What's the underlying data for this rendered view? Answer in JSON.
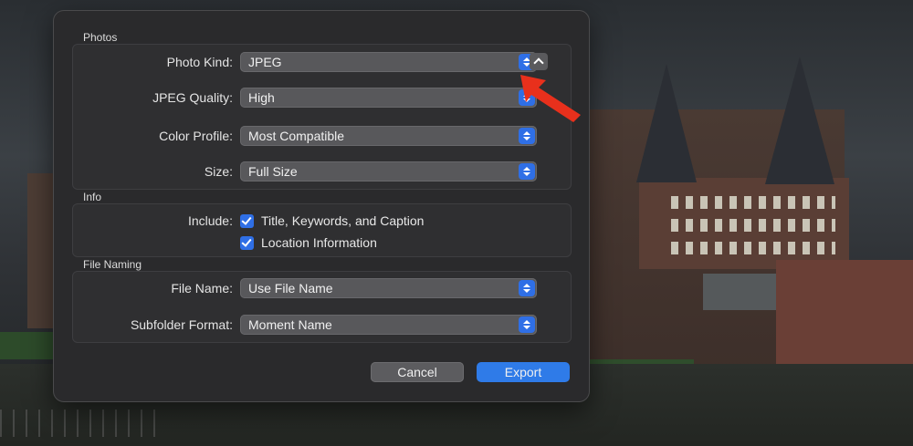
{
  "dialog": {
    "photos_section": {
      "title": "Photos",
      "rows": [
        {
          "label": "Photo Kind:",
          "value": "JPEG"
        },
        {
          "label": "JPEG Quality:",
          "value": "High"
        },
        {
          "label": "Color Profile:",
          "value": "Most Compatible"
        },
        {
          "label": "Size:",
          "value": "Full Size"
        }
      ]
    },
    "info_section": {
      "title": "Info",
      "include_label": "Include:",
      "options": [
        {
          "label": "Title, Keywords, and Caption",
          "checked": true
        },
        {
          "label": "Location Information",
          "checked": true
        }
      ]
    },
    "naming_section": {
      "title": "File Naming",
      "rows": [
        {
          "label": "File Name:",
          "value": "Use File Name"
        },
        {
          "label": "Subfolder Format:",
          "value": "Moment Name"
        }
      ]
    },
    "buttons": {
      "cancel": "Cancel",
      "export": "Export"
    }
  },
  "colors": {
    "accent": "#2f7be8",
    "annotation_arrow": "#e8301c"
  },
  "icons": {
    "disclosure": "chevron-up-icon",
    "popup": "updown-chevron-icon",
    "checkbox": "checkmark-icon",
    "annotation": "red-arrow-icon"
  }
}
